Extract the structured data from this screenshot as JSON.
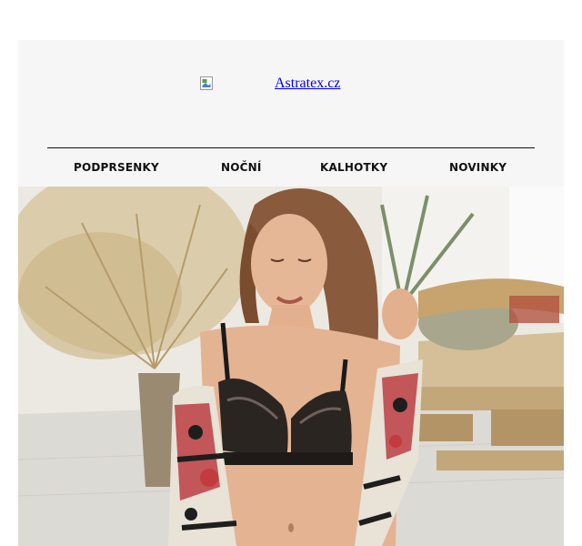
{
  "header": {
    "logo_alt": "Astratex.cz",
    "logo_icon": "broken-image-icon"
  },
  "nav": {
    "items": [
      {
        "label": "PODPRSENKY"
      },
      {
        "label": "NOČNÍ"
      },
      {
        "label": "KALHOTKY"
      },
      {
        "label": "NOVINKY"
      }
    ]
  },
  "hero": {
    "image": "lingerie-model-photo"
  },
  "colors": {
    "background": "#ffffff",
    "panel": "#f6f6f6",
    "link": "#0000ee",
    "nav_text": "#111111"
  }
}
